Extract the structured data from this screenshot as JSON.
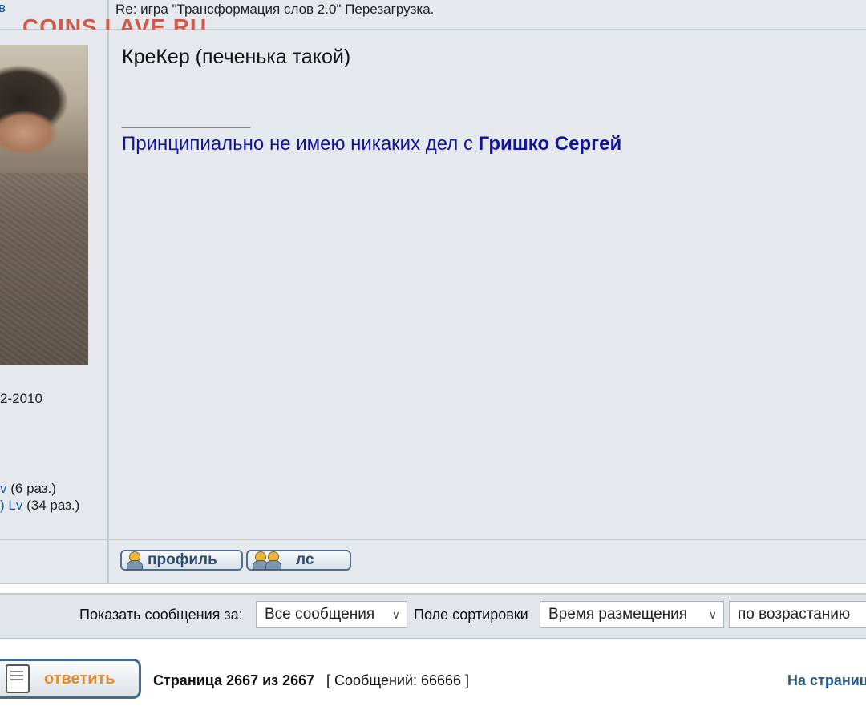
{
  "header": {
    "left_link": "в",
    "subject": "Re: игра \"Трансформация слов 2.0\" Перезагрузка.",
    "watermark": "COINS.LAVE.RU"
  },
  "author": {
    "reg_date": "2-2010",
    "thanks": [
      {
        "lv": "v",
        "count": "(6 раз.)"
      },
      {
        "lv": ") Lv",
        "count": "(34 раз.)"
      }
    ]
  },
  "post": {
    "title": "КреКер (печенька такой)",
    "sig_separator": "________________",
    "sig_text": "Принципиально не имею никаких дел с ",
    "sig_name": "Гришко Сергей"
  },
  "buttons": {
    "profile": "профиль",
    "pm": "лс"
  },
  "filter": {
    "show_label": "Показать сообщения за:",
    "show_value": "Все сообщения",
    "sort_label": "Поле сортировки",
    "sort_value": "Время размещения",
    "order_value": "по возрастанию"
  },
  "footer": {
    "reply_label": "ответить",
    "page_info": "Страница 2667 из 2667",
    "messages": "[ Сообщений: 66666 ]",
    "to_page": "На страниц"
  }
}
